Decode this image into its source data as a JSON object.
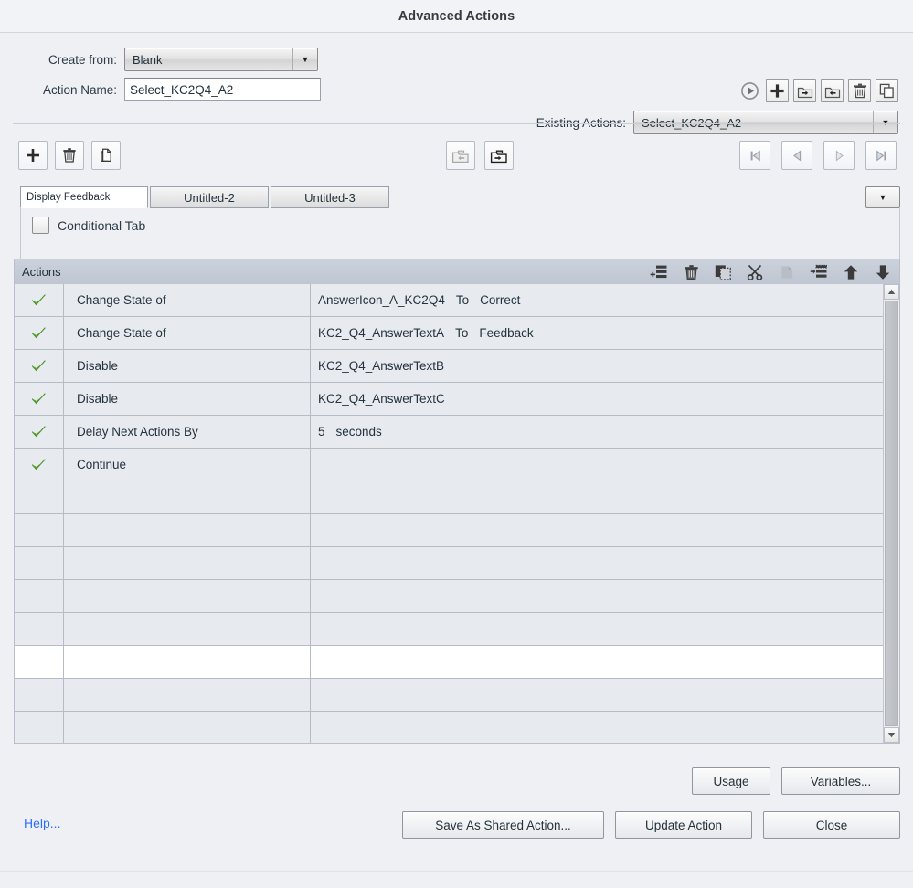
{
  "window": {
    "title": "Advanced Actions"
  },
  "form": {
    "create_from_label": "Create from:",
    "create_from_value": "Blank",
    "action_name_label": "Action Name:",
    "action_name_value": "Select_KC2Q4_A2",
    "existing_actions_label": "Existing Actions:",
    "existing_actions_value": "Select_KC2Q4_A2"
  },
  "top_toolbar": {
    "preview_label": "Preview",
    "add_label": "Add",
    "export_label": "Export",
    "import_label": "Import",
    "delete_label": "Delete",
    "duplicate_label": "Duplicate"
  },
  "tab_toolbar": {
    "add_tab_label": "Add Tab",
    "delete_tab_label": "Delete Tab",
    "duplicate_tab_label": "Duplicate Tab",
    "import_shared_label": "Import Shared Action",
    "export_shared_label": "Export Shared Action",
    "first_label": "First",
    "previous_label": "Previous",
    "next_label": "Next",
    "last_label": "Last",
    "overflow_label": "More Tabs"
  },
  "tabs": [
    {
      "label": "Display Feedback",
      "active": true
    },
    {
      "label": "Untitled-2",
      "active": false
    },
    {
      "label": "Untitled-3",
      "active": false
    }
  ],
  "conditional": {
    "label": "Conditional Tab",
    "checked": false
  },
  "actions_panel": {
    "header": "Actions",
    "icons": {
      "add_action": "add-action-icon",
      "delete_action": "delete-action-icon",
      "copy_action": "copy-action-icon",
      "cut_action": "cut-action-icon",
      "paste_action": "paste-action-icon",
      "insert_action": "insert-action-icon",
      "move_up": "move-up-icon",
      "move_down": "move-down-icon"
    }
  },
  "action_rows": [
    {
      "enabled": true,
      "action": "Change State of",
      "params": [
        "AnswerIcon_A_KC2Q4",
        "To",
        "Correct"
      ],
      "selected": false
    },
    {
      "enabled": true,
      "action": "Change State of",
      "params": [
        "KC2_Q4_AnswerTextA",
        "To",
        "Feedback"
      ],
      "selected": false
    },
    {
      "enabled": true,
      "action": "Disable",
      "params": [
        "KC2_Q4_AnswerTextB"
      ],
      "selected": false
    },
    {
      "enabled": true,
      "action": "Disable",
      "params": [
        "KC2_Q4_AnswerTextC"
      ],
      "selected": false
    },
    {
      "enabled": true,
      "action": "Delay Next Actions By",
      "params": [
        "5",
        "seconds"
      ],
      "selected": false
    },
    {
      "enabled": true,
      "action": "Continue",
      "params": [],
      "selected": false
    },
    {
      "enabled": false,
      "action": "",
      "params": [],
      "selected": false
    },
    {
      "enabled": false,
      "action": "",
      "params": [],
      "selected": false
    },
    {
      "enabled": false,
      "action": "",
      "params": [],
      "selected": false
    },
    {
      "enabled": false,
      "action": "",
      "params": [],
      "selected": false
    },
    {
      "enabled": false,
      "action": "",
      "params": [],
      "selected": false
    },
    {
      "enabled": false,
      "action": "",
      "params": [],
      "selected": true
    },
    {
      "enabled": false,
      "action": "",
      "params": [],
      "selected": false
    },
    {
      "enabled": false,
      "action": "",
      "params": [],
      "selected": false
    }
  ],
  "footer": {
    "usage_label": "Usage",
    "variables_label": "Variables...",
    "save_as_shared_label": "Save As Shared Action...",
    "update_action_label": "Update Action",
    "close_label": "Close",
    "help_label": "Help..."
  },
  "colors": {
    "window_bg": "#eef0f4",
    "titlebar_bg": "#f2f3f6",
    "table_row_bg": "#e7eaef",
    "table_row_selected_bg": "#ffffff",
    "table_header_bg": "#c6ccd6",
    "link": "#2f6fff",
    "check_green": "#52a72b",
    "text": "#2b3a45"
  }
}
